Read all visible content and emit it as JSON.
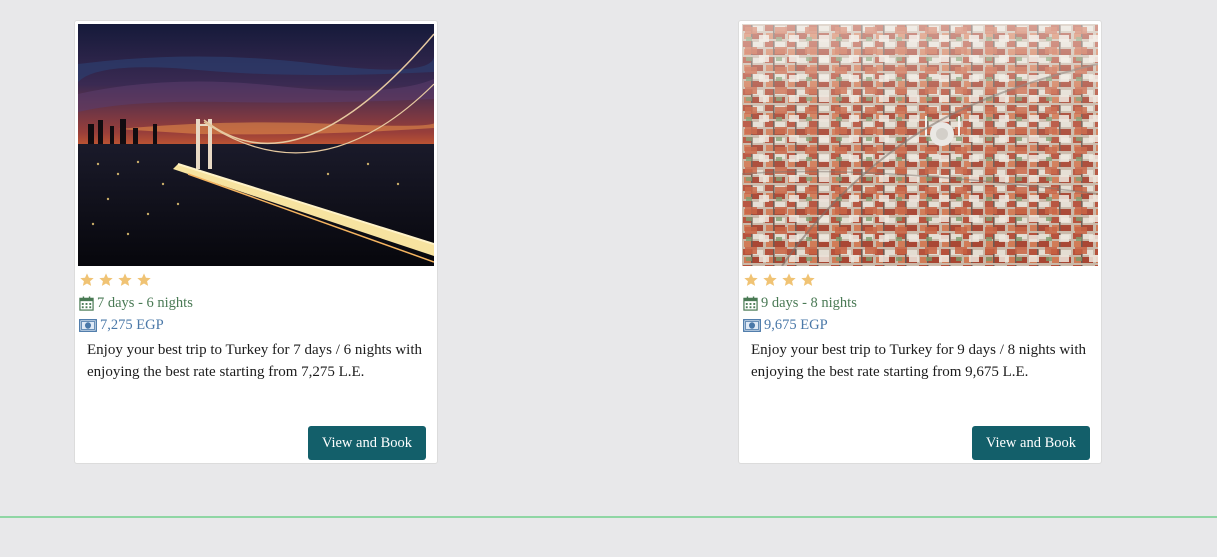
{
  "colors": {
    "background": "#e8e8ea",
    "button": "#135f6a",
    "star": "#f0c374",
    "duration_text": "#4a7a55",
    "price_text": "#4a78a8",
    "footer_line": "#8fd6a4"
  },
  "cards": [
    {
      "image": "istanbul-bosphorus-bridge-sunset",
      "rating": 4,
      "duration": "7 days - 6 nights",
      "price": "7,275 EGP",
      "description": "Enjoy your best trip to Turkey for 7 days / 6 nights with enjoying the best rate starting from 7,275 L.E.",
      "button_label": "View and Book"
    },
    {
      "image": "istanbul-aerial-rooftops",
      "rating": 4,
      "duration": "9 days - 8 nights",
      "price": "9,675 EGP",
      "description": "Enjoy your best trip to Turkey for 9 days / 8 nights with enjoying the best rate starting from 9,675 L.E.",
      "button_label": "View and Book"
    }
  ]
}
